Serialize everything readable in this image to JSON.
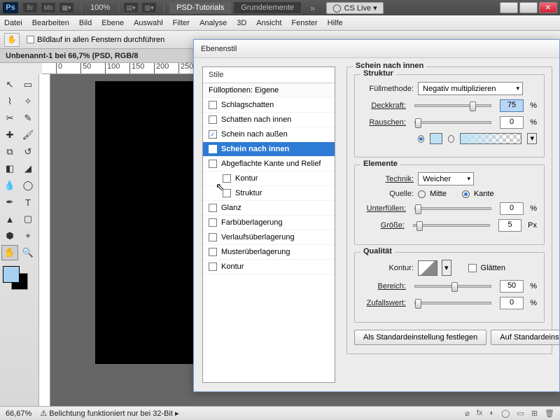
{
  "appbar": {
    "zoom": "100%",
    "tab_tutorials": "PSD-Tutorials",
    "tab_grund": "Grundelemente",
    "cslive": "CS Live"
  },
  "menu": [
    "Datei",
    "Bearbeiten",
    "Bild",
    "Ebene",
    "Auswahl",
    "Filter",
    "Analyse",
    "3D",
    "Ansicht",
    "Fenster",
    "Hilfe"
  ],
  "optbar": {
    "scroll_all": "Bildlauf in allen Fenstern durchführen"
  },
  "doc": {
    "title": "Unbenannt-1 bei 66,7% (PSD, RGB/8"
  },
  "ruler": {
    "marks": [
      "0",
      "50",
      "100",
      "150",
      "200",
      "250"
    ]
  },
  "status": {
    "zoom": "66,67%",
    "msg": "Belichtung funktioniert nur bei 32-Bit"
  },
  "dialog": {
    "title": "Ebenenstil",
    "styles_header": "Stile",
    "fill_opts": "Fülloptionen: Eigene",
    "items": [
      {
        "label": "Schlagschatten",
        "checked": false,
        "sub": false
      },
      {
        "label": "Schatten nach innen",
        "checked": false,
        "sub": false
      },
      {
        "label": "Schein nach außen",
        "checked": true,
        "sub": false
      },
      {
        "label": "Schein nach innen",
        "checked": true,
        "sub": false,
        "selected": true
      },
      {
        "label": "Abgeflachte Kante und Relief",
        "checked": false,
        "sub": false
      },
      {
        "label": "Kontur",
        "checked": false,
        "sub": true
      },
      {
        "label": "Struktur",
        "checked": false,
        "sub": true
      },
      {
        "label": "Glanz",
        "checked": false,
        "sub": false
      },
      {
        "label": "Farbüberlagerung",
        "checked": false,
        "sub": false
      },
      {
        "label": "Verlaufsüberlagerung",
        "checked": false,
        "sub": false
      },
      {
        "label": "Musterüberlagerung",
        "checked": false,
        "sub": false
      },
      {
        "label": "Kontur",
        "checked": false,
        "sub": false
      }
    ],
    "section_title": "Schein nach innen",
    "struktur": {
      "legend": "Struktur",
      "blend_label": "Füllmethode:",
      "blend_value": "Negativ multiplizieren",
      "opacity_label": "Deckkraft:",
      "opacity_value": "75",
      "noise_label": "Rauschen:",
      "noise_value": "0"
    },
    "elemente": {
      "legend": "Elemente",
      "technik_label": "Technik:",
      "technik_value": "Weicher",
      "quelle_label": "Quelle:",
      "quelle_opt1": "Mitte",
      "quelle_opt2": "Kante",
      "unterfuellen_label": "Unterfüllen:",
      "unterfuellen_value": "0",
      "groesse_label": "Größe:",
      "groesse_value": "5",
      "groesse_unit": "Px"
    },
    "qualitaet": {
      "legend": "Qualität",
      "kontur_label": "Kontur:",
      "glaetten_label": "Glätten",
      "bereich_label": "Bereich:",
      "bereich_value": "50",
      "zufall_label": "Zufallswert:",
      "zufall_value": "0"
    },
    "pct": "%",
    "btn_default": "Als Standardeinstellung festlegen",
    "btn_reset": "Auf Standardeinstellung zurück"
  }
}
